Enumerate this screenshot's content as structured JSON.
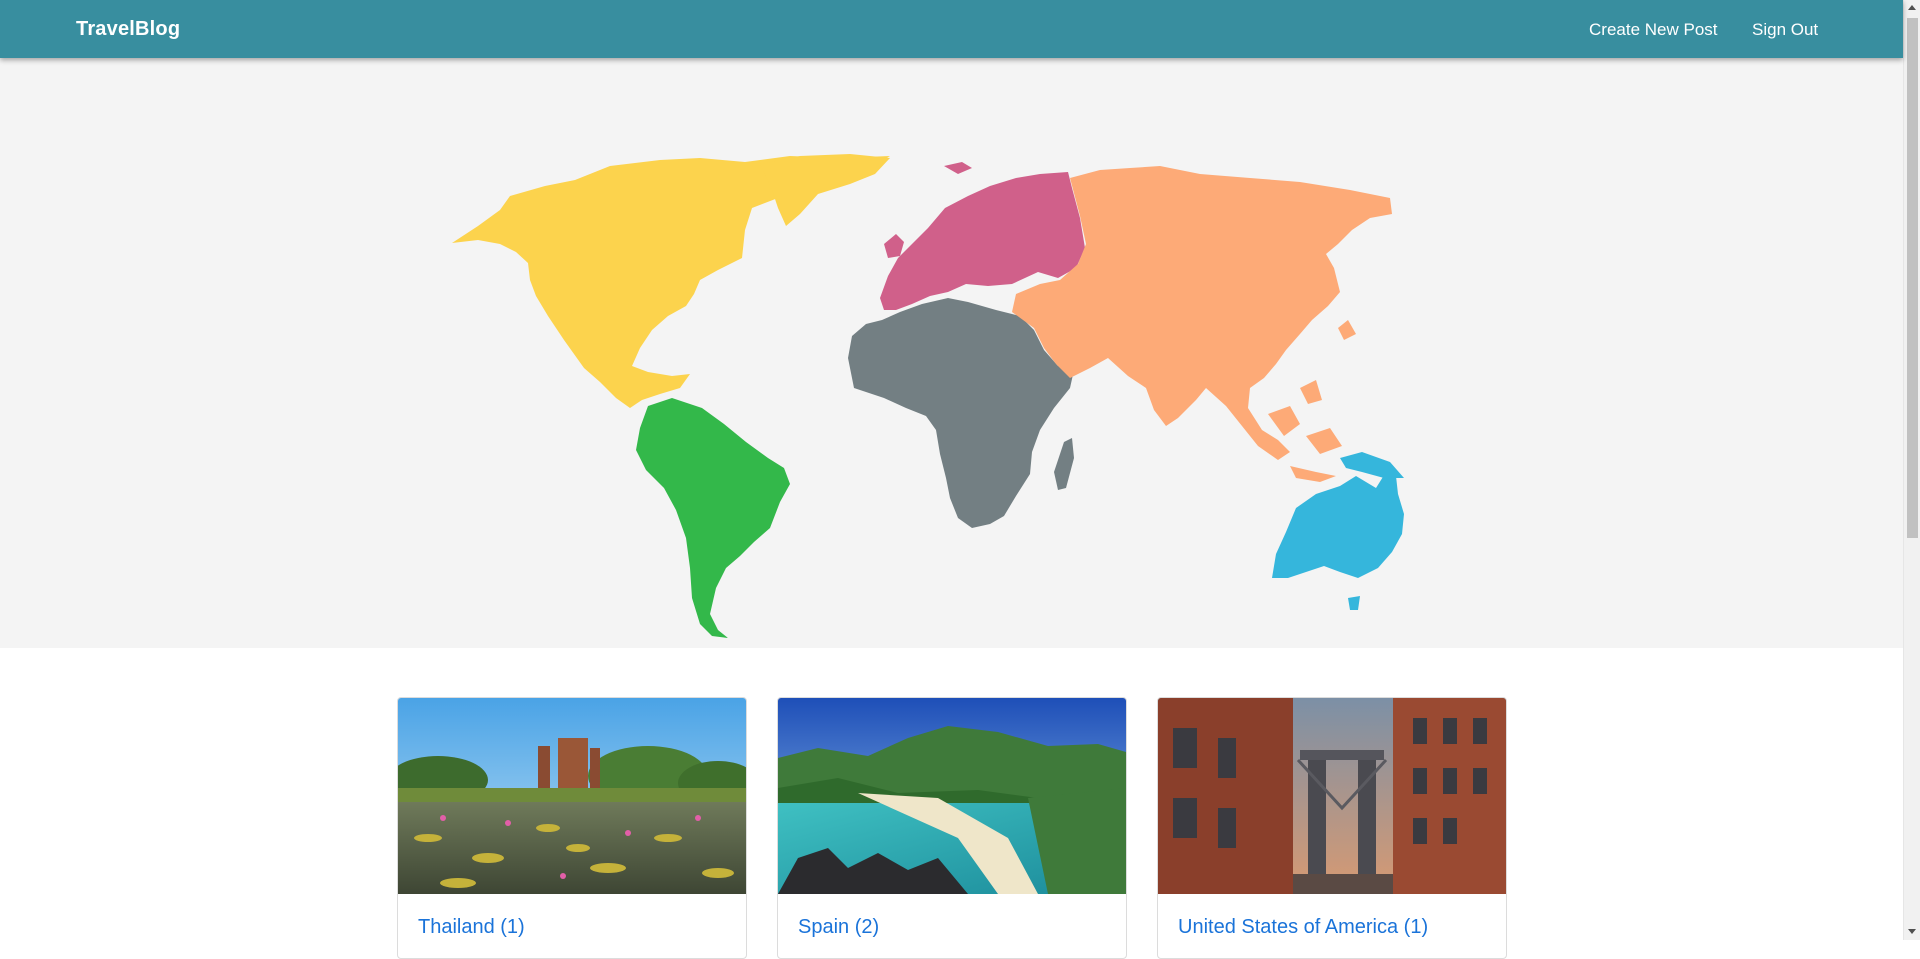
{
  "nav": {
    "brand": "TravelBlog",
    "create_post": "Create New Post",
    "sign_out": "Sign Out"
  },
  "colors": {
    "navbar": "#388e9f",
    "hero_bg": "#f4f4f4",
    "north_america": "#fcd34d",
    "south_america": "#33b84a",
    "europe": "#d0608a",
    "africa": "#737f83",
    "asia": "#fdaa77",
    "australia": "#35b6dc",
    "card_title": "#1a73d9"
  },
  "map": {
    "regions": [
      "north-america",
      "south-america",
      "europe",
      "africa",
      "asia",
      "australia"
    ]
  },
  "cards": [
    {
      "title": "Thailand (1)",
      "image": "thailand-temple-lotus-pond"
    },
    {
      "title": "Spain (2)",
      "image": "spain-tropical-beach"
    },
    {
      "title": "United States of America (1)",
      "image": "usa-manhattan-bridge-street"
    }
  ]
}
